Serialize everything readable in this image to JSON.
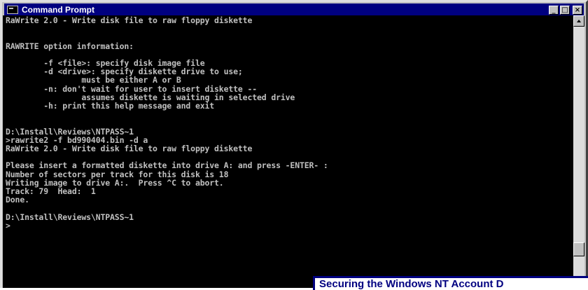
{
  "window": {
    "title": "Command Prompt",
    "buttons": {
      "minimize": "_",
      "maximize": "□",
      "close": "×"
    }
  },
  "console": {
    "lines": [
      "RaWrite 2.0 - Write disk file to raw floppy diskette",
      "",
      "",
      "RAWRITE option information:",
      "",
      "        -f <file>: specify disk image file",
      "        -d <drive>: specify diskette drive to use;",
      "                must be either A or B",
      "        -n: don't wait for user to insert diskette --",
      "                assumes diskette is waiting in selected drive",
      "        -h: print this help message and exit",
      "",
      "",
      "D:\\Install\\Reviews\\NTPASS~1",
      ">rawrite2 -f bd990404.bin -d a",
      "RaWrite 2.0 - Write disk file to raw floppy diskette",
      "",
      "Please insert a formatted diskette into drive A: and press -ENTER- :",
      "Number of sectors per track for this disk is 18",
      "Writing image to drive A:.  Press ^C to abort.",
      "Track: 79  Head:  1",
      "Done.",
      "",
      "D:\\Install\\Reviews\\NTPASS~1",
      ">"
    ]
  },
  "caption": {
    "text": "Securing the Windows NT Account D"
  },
  "colors": {
    "titlebar": "#000080",
    "console_bg": "#000000",
    "console_text": "#c0c0c0",
    "caption_text": "#000080"
  },
  "icons": {
    "window_icon": "console-window-icon",
    "scroll_up": "arrow-up-icon"
  }
}
